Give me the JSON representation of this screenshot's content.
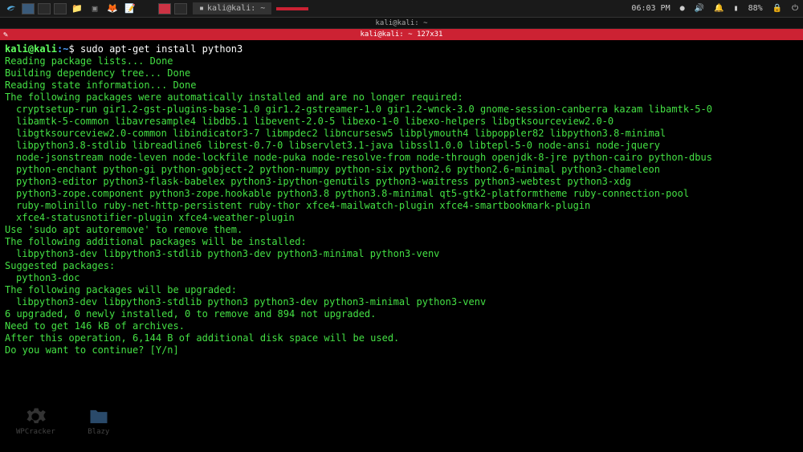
{
  "taskbar": {
    "task1": "kali@kali: ~",
    "battery": "88%",
    "time": "06:03 PM"
  },
  "window": {
    "title": "kali@kali: ~",
    "tab": "kali@kali: ~ 127x31"
  },
  "prompt": {
    "user": "kali",
    "host": "@kali",
    "path": ":~",
    "dollar": "$",
    "command": "sudo apt-get install python3"
  },
  "lines": {
    "l1": "Reading package lists... Done",
    "l2": "Building dependency tree... Done",
    "l3": "Reading state information... Done",
    "l4": "The following packages were automatically installed and are no longer required:",
    "l5": "cryptsetup-run gir1.2-gst-plugins-base-1.0 gir1.2-gstreamer-1.0 gir1.2-wnck-3.0 gnome-session-canberra kazam libamtk-5-0",
    "l6": "libamtk-5-common libavresample4 libdb5.1 libevent-2.0-5 libexo-1-0 libexo-helpers libgtksourceview2.0-0",
    "l7": "libgtksourceview2.0-common libindicator3-7 libmpdec2 libncursesw5 libplymouth4 libpoppler82 libpython3.8-minimal",
    "l8": "libpython3.8-stdlib libreadline6 librest-0.7-0 libservlet3.1-java libssl1.0.0 libtepl-5-0 node-ansi node-jquery",
    "l9": "node-jsonstream node-leven node-lockfile node-puka node-resolve-from node-through openjdk-8-jre python-cairo python-dbus",
    "l10": "python-enchant python-gi python-gobject-2 python-numpy python-six python2.6 python2.6-minimal python3-chameleon",
    "l11": "python3-editor python3-flask-babelex python3-ipython-genutils python3-waitress python3-webtest python3-xdg",
    "l12": "python3-zope.component python3-zope.hookable python3.8 python3.8-minimal qt5-gtk2-platformtheme ruby-connection-pool",
    "l13": "ruby-molinillo ruby-net-http-persistent ruby-thor xfce4-mailwatch-plugin xfce4-smartbookmark-plugin",
    "l14": "xfce4-statusnotifier-plugin xfce4-weather-plugin",
    "l15": "Use 'sudo apt autoremove' to remove them.",
    "l16": "The following additional packages will be installed:",
    "l17": "libpython3-dev libpython3-stdlib python3-dev python3-minimal python3-venv",
    "l18": "Suggested packages:",
    "l19": "python3-doc",
    "l20": "The following packages will be upgraded:",
    "l21": "libpython3-dev libpython3-stdlib python3 python3-dev python3-minimal python3-venv",
    "l22": "6 upgraded, 0 newly installed, 0 to remove and 894 not upgraded.",
    "l23": "Need to get 146 kB of archives.",
    "l24": "After this operation, 6,144 B of additional disk space will be used.",
    "l25": "Do you want to continue? [Y/n]"
  },
  "desktop": {
    "i1": "WPCracker",
    "i2": "Blazy"
  }
}
